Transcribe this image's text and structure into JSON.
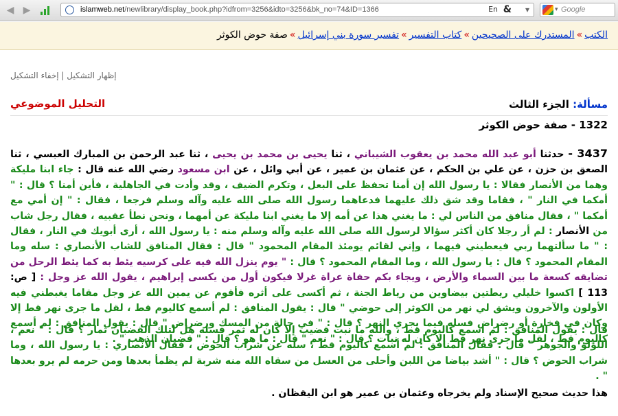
{
  "browser": {
    "url_domain": "islamweb.net",
    "url_path": "/newlibrary/display_book.php?idfrom=3256&idto=3256&bk_no=74&ID=1366",
    "search_placeholder": "Google",
    "lang_label": "En"
  },
  "breadcrumb": {
    "items": [
      "الكتب",
      "المستدرك على الصحيحين",
      "كتاب التفسير",
      "تفسير سورة بني إسرائيل"
    ],
    "current": "صفة حوض الكوثر"
  },
  "shape_toggle": {
    "show": "إظهار التشكيل",
    "hide": "إخفاء التشكيل"
  },
  "header": {
    "masala_label": "مسألة:",
    "volume": "الجزء الثالث",
    "analysis_link": "التحليل الموضوعي",
    "chapter": "1322 - صفة حوض الكوثر"
  },
  "hadith": {
    "number": "3437 -",
    "s1": "حدثنا",
    "n1": "أبو عبد الله محمد بن يعقوب الشيباني",
    "s2": "، ثنا",
    "n2": "يحيى بن محمد بن يحيى",
    "s3": "، ثنا",
    "n3": "عبد الرحمن بن المبارك العبسي",
    "s4": "، ثنا",
    "n4": "الصعق بن حزن",
    "s5": "، عن",
    "n5": "علي بن الحكم",
    "s6": "، عن",
    "n6": "عثمان بن عمير",
    "s7": "، عن",
    "n7": "أبي وائل",
    "s8": "، عن",
    "n8": "ابن مسعود",
    "s9": "رضي الله عنه قال :",
    "g1": "جاء ابنا مليكة وهما من الأنصار فقالا : يا رسول الله إن أمنا تحفظ على البعل ، وتكرم الضيف ، وقد وأدت في الجاهلية ، فأين أمنا ؟ قال : \" أمكما في النار \" ، فقاما وقد شق ذلك عليهما فدعاهما رسول الله صلى الله عليه وآله وسلم فرجعا ، فقال : \" إن أمي مع أمكما \" ، فقال منافق من الناس لي : ما يغني هذا عن أمه إلا ما يغني ابنا مليكة عن أمهما ، ونحن نطأ عقبيه ، فقال رجل شاب من",
    "b1": "الأنصار",
    "g2": ": لم أر رجلا كان أكثر سؤالا لرسول الله صلى الله عليه وآله وسلم منه : يا رسول الله ، أرى أبويك في النار ، فقال : \" ما سألتهما ربي فيعطيني فيهما ، وإني لقائم يومئذ المقام المحمود \" قال : فقال المنافق للشاب الأنصاري : سله وما المقام المحمود ؟ قال : يا رسول الله ، وما المقام المحمود ؟ قال :",
    "p1": "\" يوم ينزل الله فيه على كرسيه يئط به كما يئط الرحل من تضايقه كسعة ما بين السماء والأرض ، ويجاء بكم حفاة عراة غرلا فيكون أول من يكسى إبراهيم ، يقول الله عز وجل :",
    "page": "[ ص: 113 ]",
    "g3": "اكسوا خليلي ريطتين بيضاوين من رياط الجنة ، ثم أكسى على أثره فأقوم عن يمين الله عز وجل مقاما يغبطني فيه الأولون والآخرون ويشق لي نهر من الكوثر إلى حوضي \" قال : يقول المنافق : لم أسمع كاليوم قط ، لقل ما جرى نهر قط إلا وكان في فخارة أو رضراض فسله فيما يجري النهر ؟ قال : \" في حالة من المسك ورضراض \" قال : يقول المنافق : لم أسمع كاليوم قط ، لقل ما جرى نهر قط إلا كان له نبات ؟ قال : \" نعم \" قال : ما هو ؟ قال : \" قضبان الذهب \" ."
  },
  "para2": {
    "text": "قال : يقول المنافق : لم أسمع كاليوم قط ، والله ما نبت قضيب إلا كان له ثمر فسله هل لتلك القضبان ثمار ؟ قال : \" نعم ، اللؤلؤ والجوهر \" قال : فقال المنافق : لم أسمع كاليوم قط ، سله عن شراب الحوض ، فقال الأنصاري : يا رسول الله ، وما شراب الحوض ؟ قال : \" أشد بياضا من اللبن وأحلى من العسل من سقاه الله منه شربة لم يظمأ بعدها ومن حرمه لم يرو بعدها \" ."
  },
  "final_note": "هذا حديث صحيح الإسناد ولم يخرجاه وعثمان بن عمير هو ابن اليقظان ."
}
